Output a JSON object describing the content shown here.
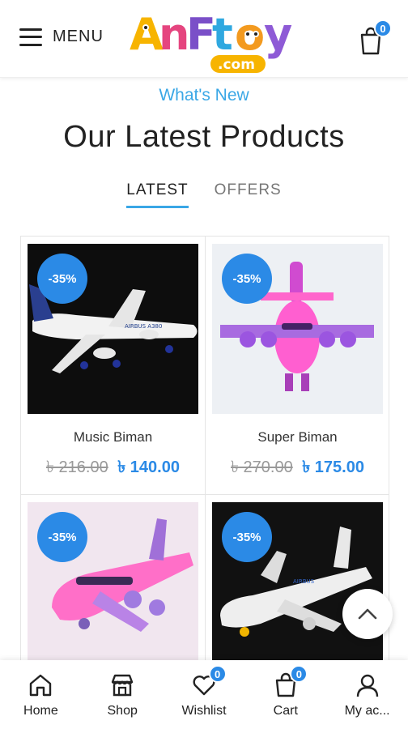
{
  "header": {
    "menu_label": "MENU",
    "logo_text": "AnFtoy",
    "logo_subtext": ".com",
    "cart_count": "0"
  },
  "section": {
    "kicker": "What's New",
    "title": "Our Latest Products",
    "tabs": [
      {
        "label": "LATEST",
        "active": true
      },
      {
        "label": "OFFERS",
        "active": false
      }
    ]
  },
  "products": [
    {
      "name": "Music Biman",
      "old_price": "৳ 216.00",
      "new_price": "৳ 140.00",
      "discount": "-35%"
    },
    {
      "name": "Super Biman",
      "old_price": "৳ 270.00",
      "new_price": "৳ 175.00",
      "discount": "-35%"
    },
    {
      "name": "",
      "old_price": "",
      "new_price": "",
      "discount": "-35%"
    },
    {
      "name": "",
      "old_price": "",
      "new_price": "",
      "discount": "-35%"
    }
  ],
  "bottom_nav": {
    "items": [
      {
        "label": "Home",
        "icon": "home-icon"
      },
      {
        "label": "Shop",
        "icon": "shop-icon"
      },
      {
        "label": "Wishlist",
        "icon": "heart-icon",
        "badge": "0"
      },
      {
        "label": "Cart",
        "icon": "cart-icon",
        "badge": "0"
      },
      {
        "label": "My ac...",
        "icon": "user-icon"
      }
    ]
  },
  "colors": {
    "accent": "#2b8ae6",
    "kicker": "#3aa7e6"
  }
}
